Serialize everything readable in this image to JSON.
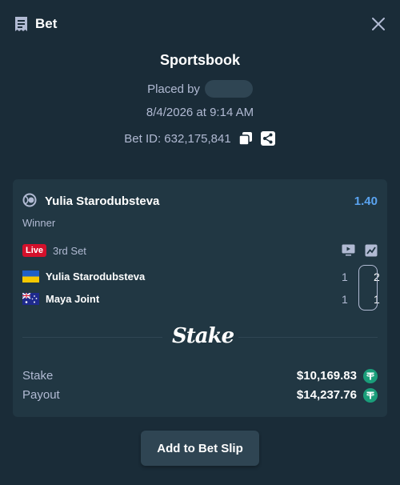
{
  "header": {
    "title": "Bet",
    "icon": "receipt-icon",
    "close_icon": "close-icon"
  },
  "info": {
    "title": "Sportsbook",
    "placed_by_label": "Placed by",
    "date": "8/4/2026 at 9:14 AM",
    "bet_id": "Bet ID: 632,175,841",
    "copy_icon": "copy-icon",
    "share_icon": "share-icon"
  },
  "selection": {
    "sport_icon": "tennis-ball-icon",
    "name": "Yulia Starodubsteva",
    "odds": "1.40",
    "market": "Winner",
    "odds_color": "#5aa3f0"
  },
  "match": {
    "live_label": "Live",
    "live_color": "#d4102b",
    "set": "3rd Set",
    "tv_icon": "tv-icon",
    "stats_icon": "stats-chart-icon",
    "teams": [
      {
        "name": "Yulia Starodubsteva",
        "flag": "ukraine-flag-icon",
        "score_sets": "1",
        "score_current": "2"
      },
      {
        "name": "Maya Joint",
        "flag": "australia-flag-icon",
        "score_sets": "1",
        "score_current": "1"
      }
    ]
  },
  "brand": {
    "logo": "Stake"
  },
  "summary": {
    "stake_label": "Stake",
    "stake_value": "$10,169.83",
    "payout_label": "Payout",
    "payout_value": "$14,237.76",
    "currency_icon": "tether-icon",
    "currency_color": "#1a9e7a"
  },
  "actions": {
    "add_to_slip": "Add to Bet Slip"
  },
  "colors": {
    "background": "#1a2c38",
    "card": "#213743",
    "muted_text": "#b1bad3",
    "button": "#2f4553"
  }
}
